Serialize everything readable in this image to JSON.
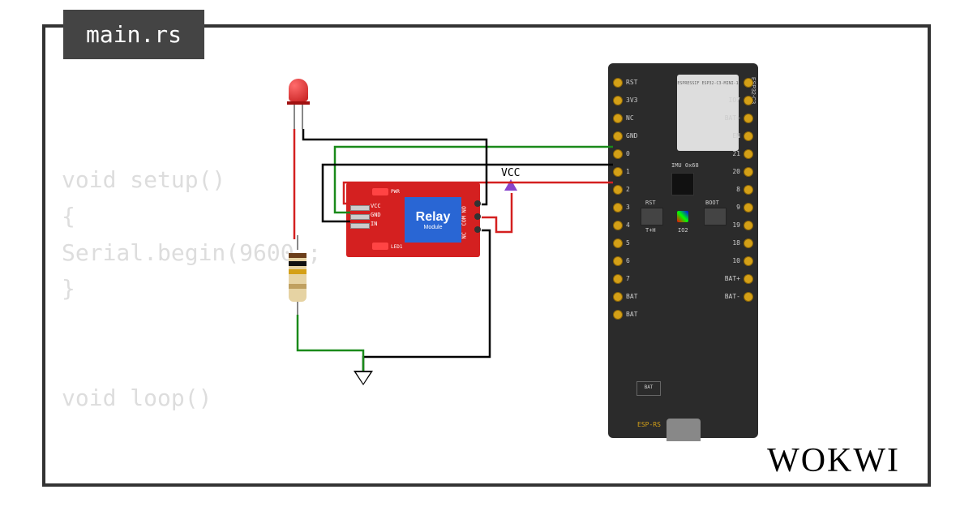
{
  "tab": {
    "filename": "main.rs"
  },
  "code_background": "void setup()\n{\nSerial.begin(9600 ;\n}\n\n\nvoid loop()",
  "brand": "WOKWI",
  "components": {
    "led": {
      "color": "red"
    },
    "resistor": {
      "bands": [
        "#6b3e1a",
        "#111",
        "#d4a017",
        "#c0a060"
      ]
    },
    "relay": {
      "title": "Relay",
      "subtitle": "Module",
      "input_pins": [
        "VCC",
        "GND",
        "IN"
      ],
      "output_pins": [
        "NO",
        "COM",
        "NC"
      ],
      "led_pwr": "PWR",
      "led_1": "LED1"
    },
    "vcc_symbol": {
      "label": "VCC"
    },
    "esp32": {
      "shield_text": "ESPRESSIF\nESP32-C3-MINI-1",
      "side_label": "ESP32-C3",
      "imu_label": "IMU\n0x68",
      "rst_label": "RST",
      "th_label": "T+H",
      "boot_label": "BOOT",
      "io2_label": "IO2",
      "logo_text": "ESP-RS",
      "bat_label": "BAT",
      "left_pins": [
        "RST",
        "3V3",
        "NC",
        "GND",
        "0",
        "1",
        "2",
        "3",
        "4",
        "5",
        "6",
        "7",
        "BAT",
        "BAT"
      ],
      "right_pins": [
        "",
        "IO7",
        "BAT+",
        "EN",
        "21",
        "20",
        "8",
        "9",
        "19",
        "18",
        "10",
        "BAT+",
        "BAT-"
      ]
    }
  },
  "wires": [
    {
      "from": "led-anode",
      "to": "resistor-top",
      "color": "red"
    },
    {
      "from": "esp-gnd",
      "to": "relay-gnd",
      "color": "green"
    },
    {
      "from": "esp-gpio1",
      "to": "relay-vcc",
      "color": "red"
    },
    {
      "from": "esp-gpio0",
      "to": "relay-in",
      "color": "black"
    },
    {
      "from": "relay-com",
      "to": "vcc-symbol",
      "color": "red"
    },
    {
      "from": "relay-nc",
      "to": "gnd-symbol",
      "color": "black"
    },
    {
      "from": "resistor-bottom",
      "to": "gnd-symbol",
      "color": "green"
    },
    {
      "from": "led-cathode",
      "to": "relay-no",
      "color": "black"
    }
  ]
}
